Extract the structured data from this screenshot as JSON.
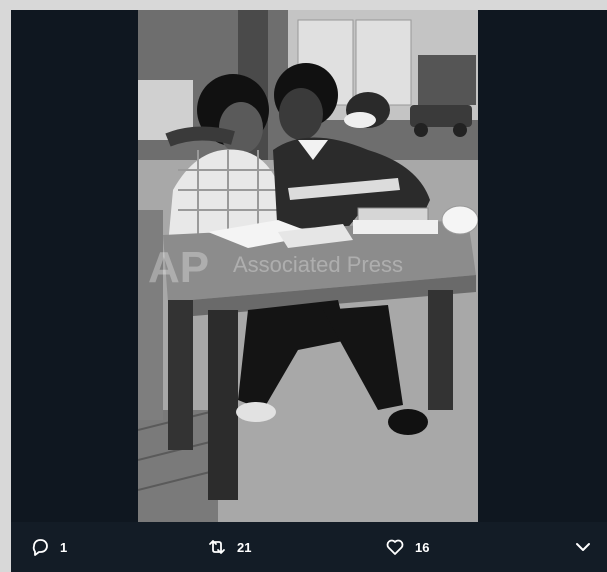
{
  "watermark": {
    "text": "Associated Press"
  },
  "actions": {
    "reply": {
      "icon": "reply-icon",
      "count": "1"
    },
    "retweet": {
      "icon": "retweet-icon",
      "count": "21"
    },
    "like": {
      "icon": "heart-icon",
      "count": "16"
    },
    "more": {
      "icon": "chevron-down-icon"
    }
  },
  "colors": {
    "page_bg": "#d8d8d8",
    "viewer_bg": "#0f1720",
    "action_bar": "#131c26",
    "text": "#ffffff"
  }
}
